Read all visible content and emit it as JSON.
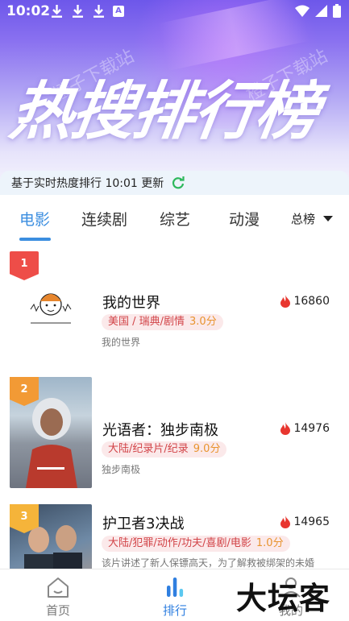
{
  "status_bar": {
    "time": "10:02",
    "letter_icon": "A"
  },
  "hero": {
    "title": "热搜排行榜",
    "watermark": "橙子下载站"
  },
  "update_bar": {
    "text": "基于实时热度排行 10:01 更新"
  },
  "tabs": {
    "items": [
      "电影",
      "连续剧",
      "综艺",
      "动漫"
    ],
    "active_index": 0,
    "filter_label": "总榜"
  },
  "ranking": [
    {
      "rank": "1",
      "title": "我的世界",
      "heat": "16860",
      "tags": "美国 / 瑞典/剧情",
      "score": "3.0分",
      "desc": "我的世界"
    },
    {
      "rank": "2",
      "title": "光语者：独步南极",
      "heat": "14976",
      "tags": "大陆/纪录片/纪录",
      "score": "9.0分",
      "desc": "独步南极"
    },
    {
      "rank": "3",
      "title": "护卫者3决战",
      "heat": "14965",
      "tags": "大陆/犯罪/动作/功夫/喜剧/电影",
      "score": "1.0分",
      "desc": "该片讲述了新人保镖高天，为了解救被绑架的未婚"
    }
  ],
  "bottom_nav": {
    "items": [
      {
        "label": "首页",
        "icon": "home-icon"
      },
      {
        "label": "排行",
        "icon": "chart-icon"
      },
      {
        "label": "我的",
        "icon": "user-icon"
      }
    ],
    "active_index": 1
  },
  "brand_overlay": "大坛客",
  "colors": {
    "accent": "#3b8ee0",
    "rank1": "#ee4d48",
    "rank2": "#f29a35",
    "rank3": "#f5b43a",
    "fire": "#e8362f",
    "refresh": "#2eb85c"
  }
}
